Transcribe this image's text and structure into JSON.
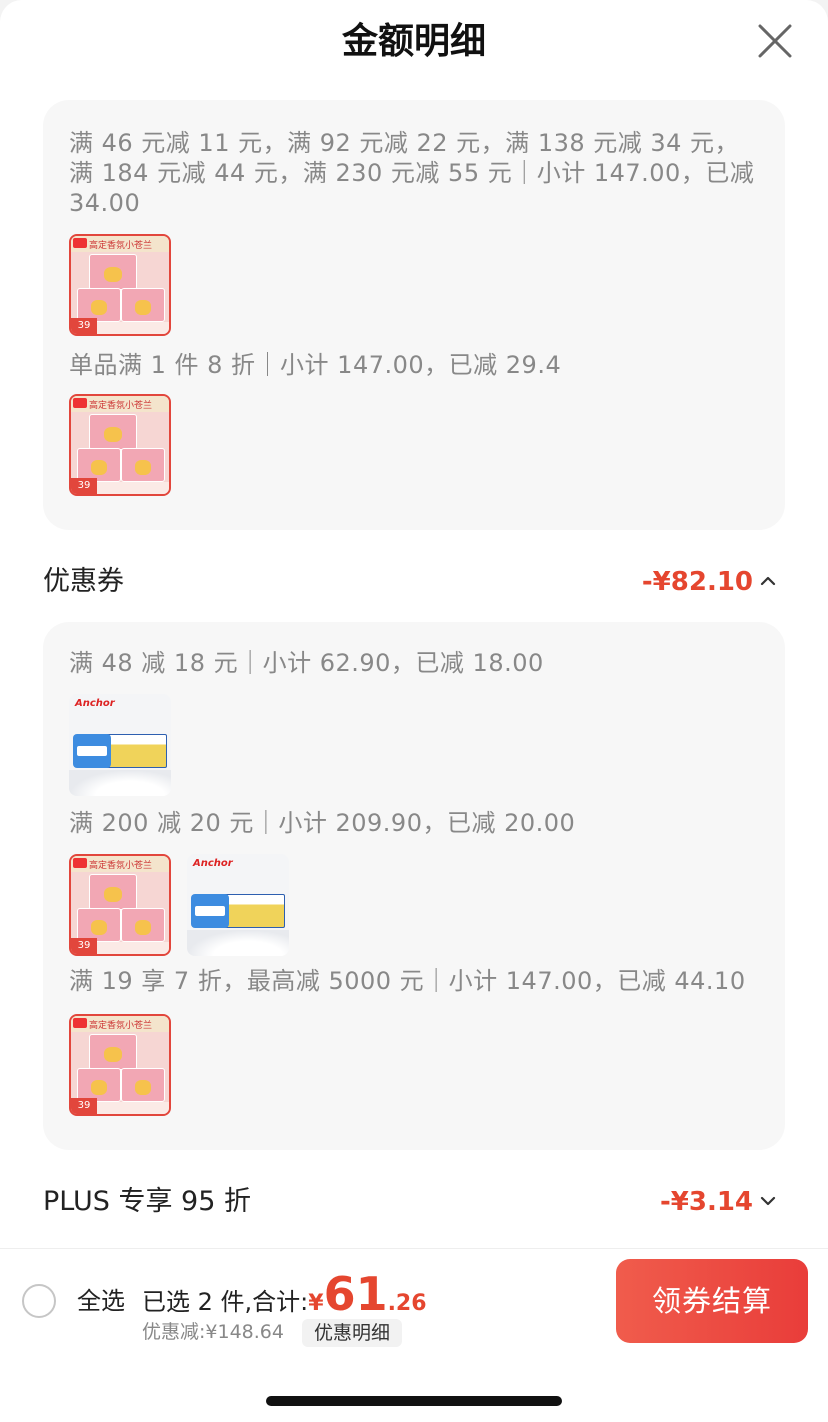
{
  "header": {
    "title": "金额明细"
  },
  "promo_card": {
    "groups": [
      {
        "rule": "满 46 元减 11 元，满 92 元减 22 元，满 138 元减 34 元，满 184 元减 44 元，满 230 元减 55 元｜小计 147.00，已减 34.00",
        "products": [
          "pink"
        ]
      },
      {
        "rule": "单品满 1 件 8 折｜小计 147.00，已减 29.4",
        "products": [
          "pink"
        ]
      }
    ]
  },
  "coupon_section": {
    "label": "优惠券",
    "amount": "-¥82.10",
    "expanded": true
  },
  "coupon_card": {
    "groups": [
      {
        "rule": "满 48 减 18 元｜小计 62.90，已减 18.00",
        "products": [
          "anchor"
        ]
      },
      {
        "rule": "满 200 减 20 元｜小计 209.90，已减 20.00",
        "products": [
          "pink",
          "anchor"
        ]
      },
      {
        "rule": "满 19 享 7 折，最高减 5000 元｜小计 147.00，已减 44.10",
        "products": [
          "pink"
        ]
      }
    ]
  },
  "plus_section": {
    "label": "PLUS 专享 95 折",
    "amount": "-¥3.14",
    "expanded": false
  },
  "product_thumb": {
    "pink_price": "39",
    "anchor_brand": "Anchor"
  },
  "bottom_bar": {
    "select_all": "全选",
    "selected_text": "已选 2 件,合计:",
    "currency": "¥",
    "total_int": "61",
    "total_dec": ".26",
    "saved": "优惠减:¥148.64",
    "detail_label": "优惠明细",
    "checkout_label": "领券结算"
  },
  "colors": {
    "accent": "#e5462f",
    "card_bg": "#f7f7f7",
    "muted_text": "#888888"
  },
  "icons": {
    "close": "close-icon",
    "chevron_up": "chevron-up-icon",
    "chevron_down": "chevron-down-icon"
  }
}
